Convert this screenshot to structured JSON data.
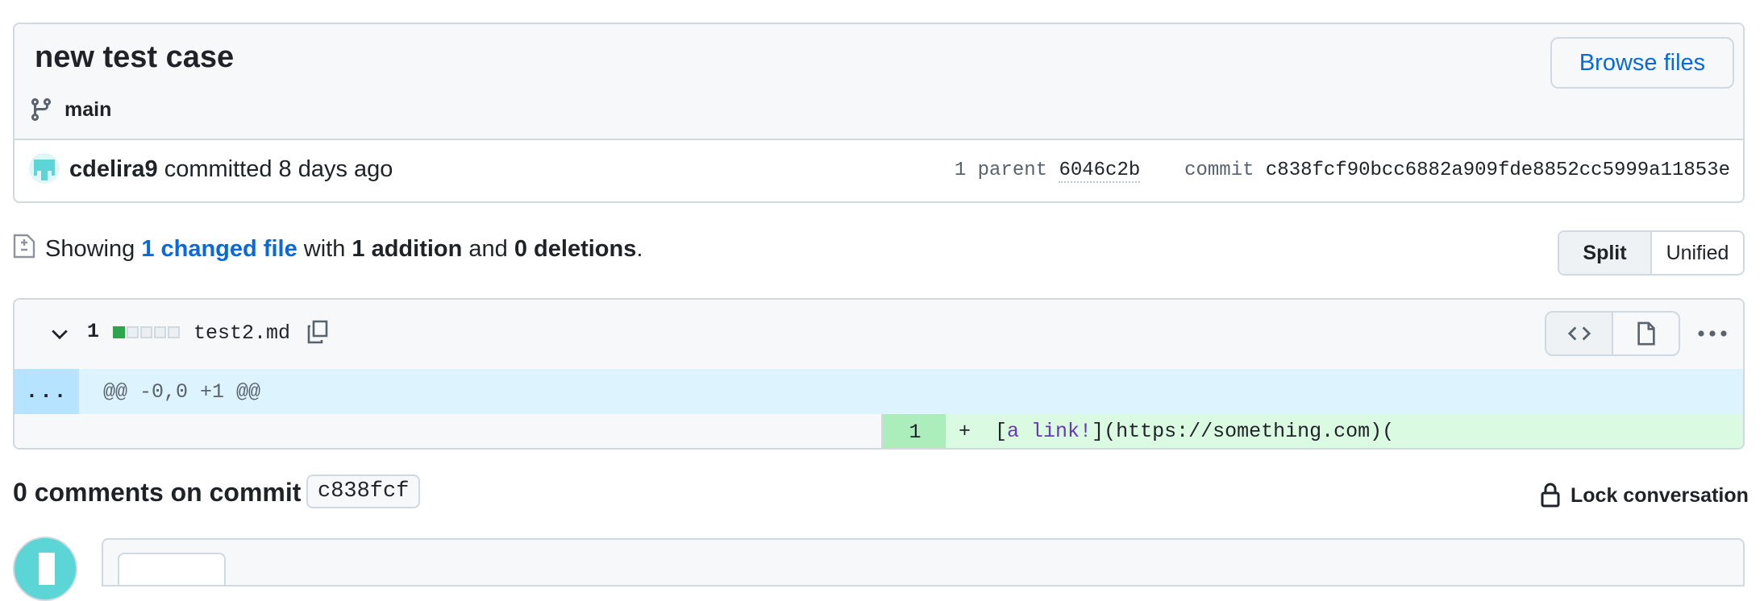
{
  "commit": {
    "title": "new test case",
    "branch": "main",
    "browse_label": "Browse files",
    "author": "cdelira9",
    "action": "committed",
    "time": "8 days ago",
    "parent_label": "1 parent",
    "parent_sha": "6046c2b",
    "commit_label": "commit",
    "commit_sha": "c838fcf90bcc6882a909fde8852cc5999a11853e"
  },
  "summary": {
    "prefix": "Showing",
    "changed": "1 changed file",
    "with": "with",
    "additions": "1 addition",
    "and": "and",
    "deletions": "0 deletions",
    "period": "."
  },
  "view_toggle": {
    "split": "Split",
    "unified": "Unified"
  },
  "file": {
    "change_count": "1",
    "name": "test2.md",
    "diffstat": {
      "additions": 1,
      "total_boxes": 5
    },
    "hunk_expand": "...",
    "hunk_header": "@@ -0,0 +1 @@",
    "added_line": {
      "number": "1",
      "marker": "+",
      "open": "[",
      "text": "a link!",
      "rest": "](https://something.com)("
    }
  },
  "comments": {
    "title": "0 comments on commit",
    "sha": "c838fcf",
    "lock_label": "Lock conversation"
  },
  "icons": {
    "branch": "git-branch-icon",
    "diff": "file-diff-icon",
    "chevron": "chevron-down-icon",
    "copy": "copy-icon",
    "code": "code-icon",
    "file": "file-icon",
    "kebab": "kebab-horizontal-icon",
    "lock": "lock-icon"
  },
  "colors": {
    "link": "#0969da",
    "add_bg": "#dafbe1",
    "add_num_bg": "#aceebb",
    "hunk_bg": "#ddf4ff",
    "border": "#d1d9e0"
  }
}
